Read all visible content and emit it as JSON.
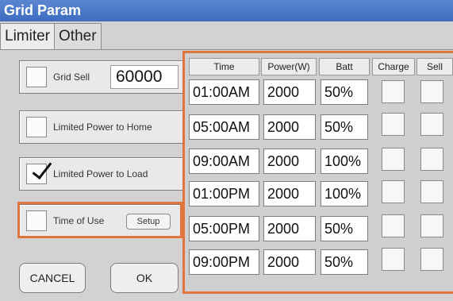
{
  "window": {
    "title": "Grid Param"
  },
  "tabs": [
    {
      "label": "Limiter",
      "active": true
    },
    {
      "label": "Other",
      "active": false
    }
  ],
  "left_panel": {
    "grid_sell": {
      "label": "Grid Sell",
      "value": "60000",
      "checked": false
    },
    "limited_power_home": {
      "label": "Limited Power to Home",
      "checked": false
    },
    "limited_power_load": {
      "label": "Limited Power to Load",
      "checked": true
    },
    "time_of_use": {
      "label": "Time of Use",
      "checked": false,
      "setup_label": "Setup"
    }
  },
  "buttons": {
    "cancel": "CANCEL",
    "ok": "OK"
  },
  "schedule": {
    "columns": [
      "Time",
      "Power(W)",
      "Batt",
      "Charge",
      "Sell"
    ],
    "rows": [
      {
        "time": "01:00AM",
        "power": "2000",
        "batt": "50%",
        "charge": false,
        "sell": false
      },
      {
        "time": "05:00AM",
        "power": "2000",
        "batt": "50%",
        "charge": false,
        "sell": false
      },
      {
        "time": "09:00AM",
        "power": "2000",
        "batt": "100%",
        "charge": false,
        "sell": false
      },
      {
        "time": "01:00PM",
        "power": "2000",
        "batt": "100%",
        "charge": false,
        "sell": false
      },
      {
        "time": "05:00PM",
        "power": "2000",
        "batt": "50%",
        "charge": false,
        "sell": false
      },
      {
        "time": "09:00PM",
        "power": "2000",
        "batt": "50%",
        "charge": false,
        "sell": false
      }
    ]
  },
  "colors": {
    "title_bar": "#4a78c8",
    "highlight": "#e0763e",
    "background": "#d2d2d2"
  }
}
